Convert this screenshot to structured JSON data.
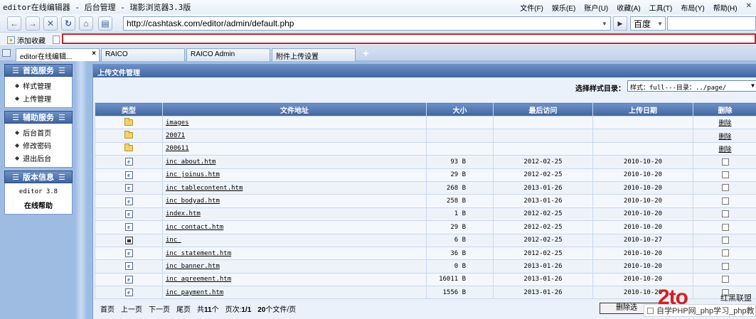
{
  "window": {
    "title": "editor在线编辑器 - 后台管理 - 瑞影浏览器3.3版",
    "menus": [
      "文件(F)",
      "娱乐(E)",
      "账户(U)",
      "收藏(A)",
      "工具(T)",
      "布局(Y)",
      "帮助(H)"
    ]
  },
  "toolbar": {
    "address": "http://cashtask.com/editor/admin/default.php",
    "search_engine": "百度"
  },
  "favorites": {
    "add_label": "添加收藏"
  },
  "tabs": [
    {
      "label": "editor在线编辑..."
    },
    {
      "label": "RAICO"
    },
    {
      "label": "RAICO Admin"
    },
    {
      "label": "附件上传设置"
    }
  ],
  "sidebar": {
    "sections": [
      {
        "title": "首选服务",
        "items": [
          "样式管理",
          "上传管理"
        ]
      },
      {
        "title": "辅助服务",
        "items": [
          "后台首页",
          "修改密码",
          "退出后台"
        ]
      },
      {
        "title": "版本信息",
        "version": "editor 3.8",
        "help": "在线帮助"
      }
    ]
  },
  "main": {
    "header": "上传文件管理",
    "style_label": "选择样式目录：",
    "style_value": "样式：full---目录：../page/"
  },
  "table": {
    "columns": [
      "类型",
      "文件地址",
      "大小",
      "最后访问",
      "上传日期",
      "删除"
    ],
    "delete_label": "删除",
    "rows": [
      {
        "type": "folder",
        "name": "images",
        "size": "",
        "accessed": "",
        "uploaded": ""
      },
      {
        "type": "folder",
        "name": "20071",
        "size": "",
        "accessed": "",
        "uploaded": ""
      },
      {
        "type": "folder",
        "name": "200611",
        "size": "",
        "accessed": "",
        "uploaded": ""
      },
      {
        "type": "htm",
        "name": "inc_about.htm",
        "size": "93 B",
        "accessed": "2012-02-25",
        "uploaded": "2010-10-20"
      },
      {
        "type": "htm",
        "name": "inc_joinus.htm",
        "size": "29 B",
        "accessed": "2012-02-25",
        "uploaded": "2010-10-20"
      },
      {
        "type": "htm",
        "name": "inc_tablecontent.htm",
        "size": "268 B",
        "accessed": "2013-01-26",
        "uploaded": "2010-10-20"
      },
      {
        "type": "htm",
        "name": "inc_bodyad.htm",
        "size": "258 B",
        "accessed": "2013-01-26",
        "uploaded": "2010-10-20"
      },
      {
        "type": "htm",
        "name": "index.htm",
        "size": "1 B",
        "accessed": "2012-02-25",
        "uploaded": "2010-10-20"
      },
      {
        "type": "htm",
        "name": "inc_contact.htm",
        "size": "29 B",
        "accessed": "2012-02-25",
        "uploaded": "2010-10-20"
      },
      {
        "type": "image",
        "name": "inc_",
        "size": "6 B",
        "accessed": "2012-02-25",
        "uploaded": "2010-10-27"
      },
      {
        "type": "htm",
        "name": "inc_statement.htm",
        "size": "36 B",
        "accessed": "2012-02-25",
        "uploaded": "2010-10-20"
      },
      {
        "type": "htm",
        "name": "inc_banner.htm",
        "size": "0 B",
        "accessed": "2013-01-26",
        "uploaded": "2010-10-20"
      },
      {
        "type": "htm",
        "name": "inc_agreement.htm",
        "size": "16011 B",
        "accessed": "2013-01-26",
        "uploaded": "2010-10-20"
      },
      {
        "type": "htm",
        "name": "inc_payment.htm",
        "size": "1556 B",
        "accessed": "2013-01-26",
        "uploaded": "2010-10-20"
      }
    ]
  },
  "pager": {
    "first": "首页",
    "prev": "上一页",
    "next": "下一页",
    "last": "尾页",
    "total_prefix": "共",
    "total": "11",
    "total_suffix": "个",
    "page_prefix": "页次:",
    "page": "1/1",
    "per_page": "20",
    "per_page_suffix": "个文件/页",
    "delete_button": "删除选"
  },
  "watermark": {
    "logo": "2to",
    "side_text": "红黑联盟",
    "strip_text": "自学PHP网_php学习_php教"
  }
}
